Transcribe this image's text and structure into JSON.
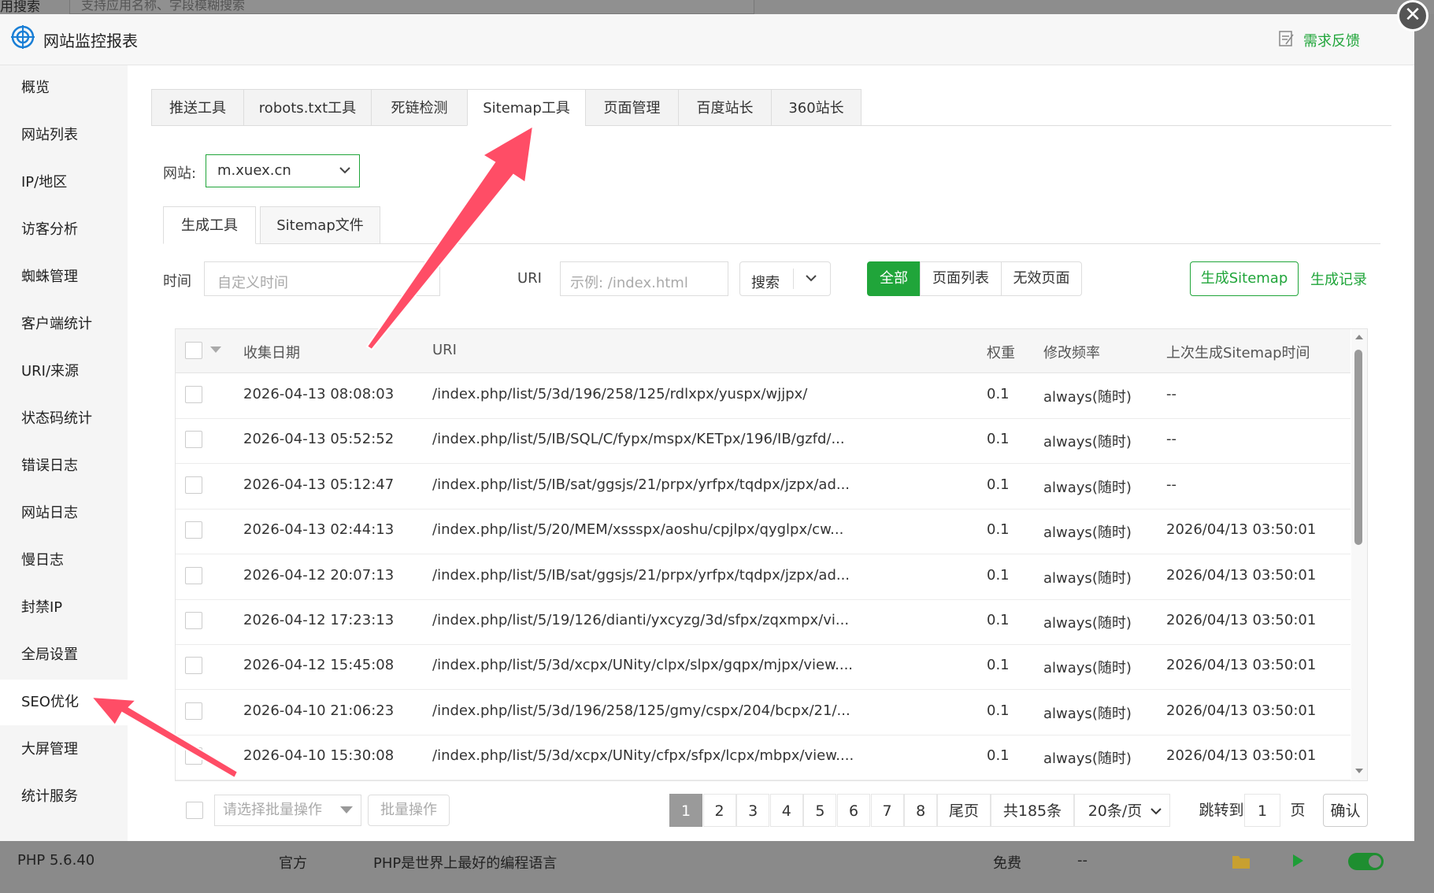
{
  "background": {
    "top_label": "用搜索",
    "top_placeholder": "支持应用名称、字段模糊搜索",
    "bottom_row": {
      "name": "PHP 5.6.40",
      "dev": "官方",
      "desc": "PHP是世界上最好的编程语言",
      "price": "免费",
      "expire": "--"
    }
  },
  "modal": {
    "title": "网站监控报表",
    "feedback": "需求反馈",
    "close_symbol": "✕"
  },
  "sidebar": {
    "items": [
      "概览",
      "网站列表",
      "IP/地区",
      "访客分析",
      "蜘蛛管理",
      "客户端统计",
      "URI/来源",
      "状态码统计",
      "错误日志",
      "网站日志",
      "慢日志",
      "封禁IP",
      "全局设置",
      "SEO优化",
      "大屏管理",
      "统计服务"
    ],
    "active_index": 13
  },
  "tabs": [
    "推送工具",
    "robots.txt工具",
    "死链检测",
    "Sitemap工具",
    "页面管理",
    "百度站长",
    "360站长"
  ],
  "active_tab": "Sitemap工具",
  "site": {
    "label": "网站:",
    "value": "m.xuex.cn"
  },
  "subtabs": [
    "生成工具",
    "Sitemap文件"
  ],
  "filters": {
    "time_label": "时间",
    "time_placeholder": "自定义时间",
    "uri_label": "URI",
    "uri_placeholder": "示例: /index.html",
    "search_label": "搜索",
    "segments": [
      "全部",
      "页面列表",
      "无效页面"
    ],
    "generate_button": "生成Sitemap",
    "generate_record": "生成记录"
  },
  "table": {
    "headers": [
      "收集日期",
      "URI",
      "权重",
      "修改频率",
      "上次生成Sitemap时间"
    ],
    "rows": [
      {
        "date": "2026-04-13 08:08:03",
        "uri": "/index.php/list/5/3d/196/258/125/rdlxpx/yuspx/wjjpx/",
        "weight": "0.1",
        "freq": "always(随时)",
        "last": "--"
      },
      {
        "date": "2026-04-13 05:52:52",
        "uri": "/index.php/list/5/IB/SQL/C/fypx/mspx/KETpx/196/IB/gzfd/...",
        "weight": "0.1",
        "freq": "always(随时)",
        "last": "--"
      },
      {
        "date": "2026-04-13 05:12:47",
        "uri": "/index.php/list/5/IB/sat/ggsjs/21/prpx/yrfpx/tqdpx/jzpx/ad...",
        "weight": "0.1",
        "freq": "always(随时)",
        "last": "--"
      },
      {
        "date": "2026-04-13 02:44:13",
        "uri": "/index.php/list/5/20/MEM/xssspx/aoshu/cpjlpx/qyglpx/cw...",
        "weight": "0.1",
        "freq": "always(随时)",
        "last": "2026/04/13 03:50:01"
      },
      {
        "date": "2026-04-12 20:07:13",
        "uri": "/index.php/list/5/IB/sat/ggsjs/21/prpx/yrfpx/tqdpx/jzpx/ad...",
        "weight": "0.1",
        "freq": "always(随时)",
        "last": "2026/04/13 03:50:01"
      },
      {
        "date": "2026-04-12 17:23:13",
        "uri": "/index.php/list/5/19/126/dianti/yxcyzg/3d/sfpx/zqxmpx/vi...",
        "weight": "0.1",
        "freq": "always(随时)",
        "last": "2026/04/13 03:50:01"
      },
      {
        "date": "2026-04-12 15:45:08",
        "uri": "/index.php/list/5/3d/xcpx/UNity/clpx/slpx/gqpx/mjpx/view....",
        "weight": "0.1",
        "freq": "always(随时)",
        "last": "2026/04/13 03:50:01"
      },
      {
        "date": "2026-04-10 21:06:23",
        "uri": "/index.php/list/5/3d/196/258/125/gmy/cspx/204/bcpx/21/...",
        "weight": "0.1",
        "freq": "always(随时)",
        "last": "2026/04/13 03:50:01"
      },
      {
        "date": "2026-04-10 15:30:08",
        "uri": "/index.php/list/5/3d/xcpx/UNity/cfpx/sfpx/lcpx/mbpx/view....",
        "weight": "0.1",
        "freq": "always(随时)",
        "last": "2026/04/13 03:50:01"
      }
    ]
  },
  "footer": {
    "batch_placeholder": "请选择批量操作",
    "batch_button": "批量操作",
    "pages": [
      "1",
      "2",
      "3",
      "4",
      "5",
      "6",
      "7",
      "8"
    ],
    "last_page": "尾页",
    "total": "共185条",
    "per_page": "20条/页",
    "jump_label": "跳转到",
    "jump_value": "1",
    "page_unit": "页",
    "confirm": "确认"
  },
  "colors": {
    "accent": "#20a53a",
    "arrow": "#ff4d66"
  }
}
